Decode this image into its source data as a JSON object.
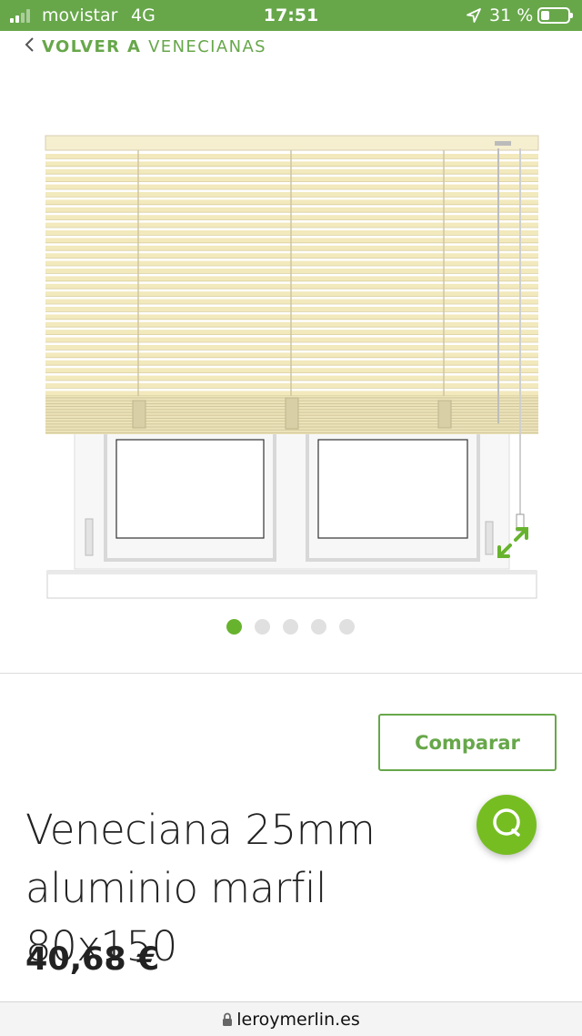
{
  "status_bar": {
    "carrier": "movistar",
    "network": "4G",
    "time": "17:51",
    "battery": "31 %"
  },
  "nav": {
    "back_prefix": "VOLVER A",
    "back_target": "VENECIANAS"
  },
  "gallery": {
    "image_count": 5,
    "active_index": 0,
    "expand_icon": "expand-icon"
  },
  "product": {
    "title": "Veneciana 25mm aluminio marfil 80x150",
    "price": "40,68 €"
  },
  "actions": {
    "compare_label": "Comparar",
    "chat_icon": "chat-icon"
  },
  "browser": {
    "url": "leroymerlin.es"
  },
  "colors": {
    "brand_green": "#67a74a",
    "status_bar": "#67a74a",
    "chat_button": "#76bd22",
    "blind": "#f2e9bd"
  }
}
